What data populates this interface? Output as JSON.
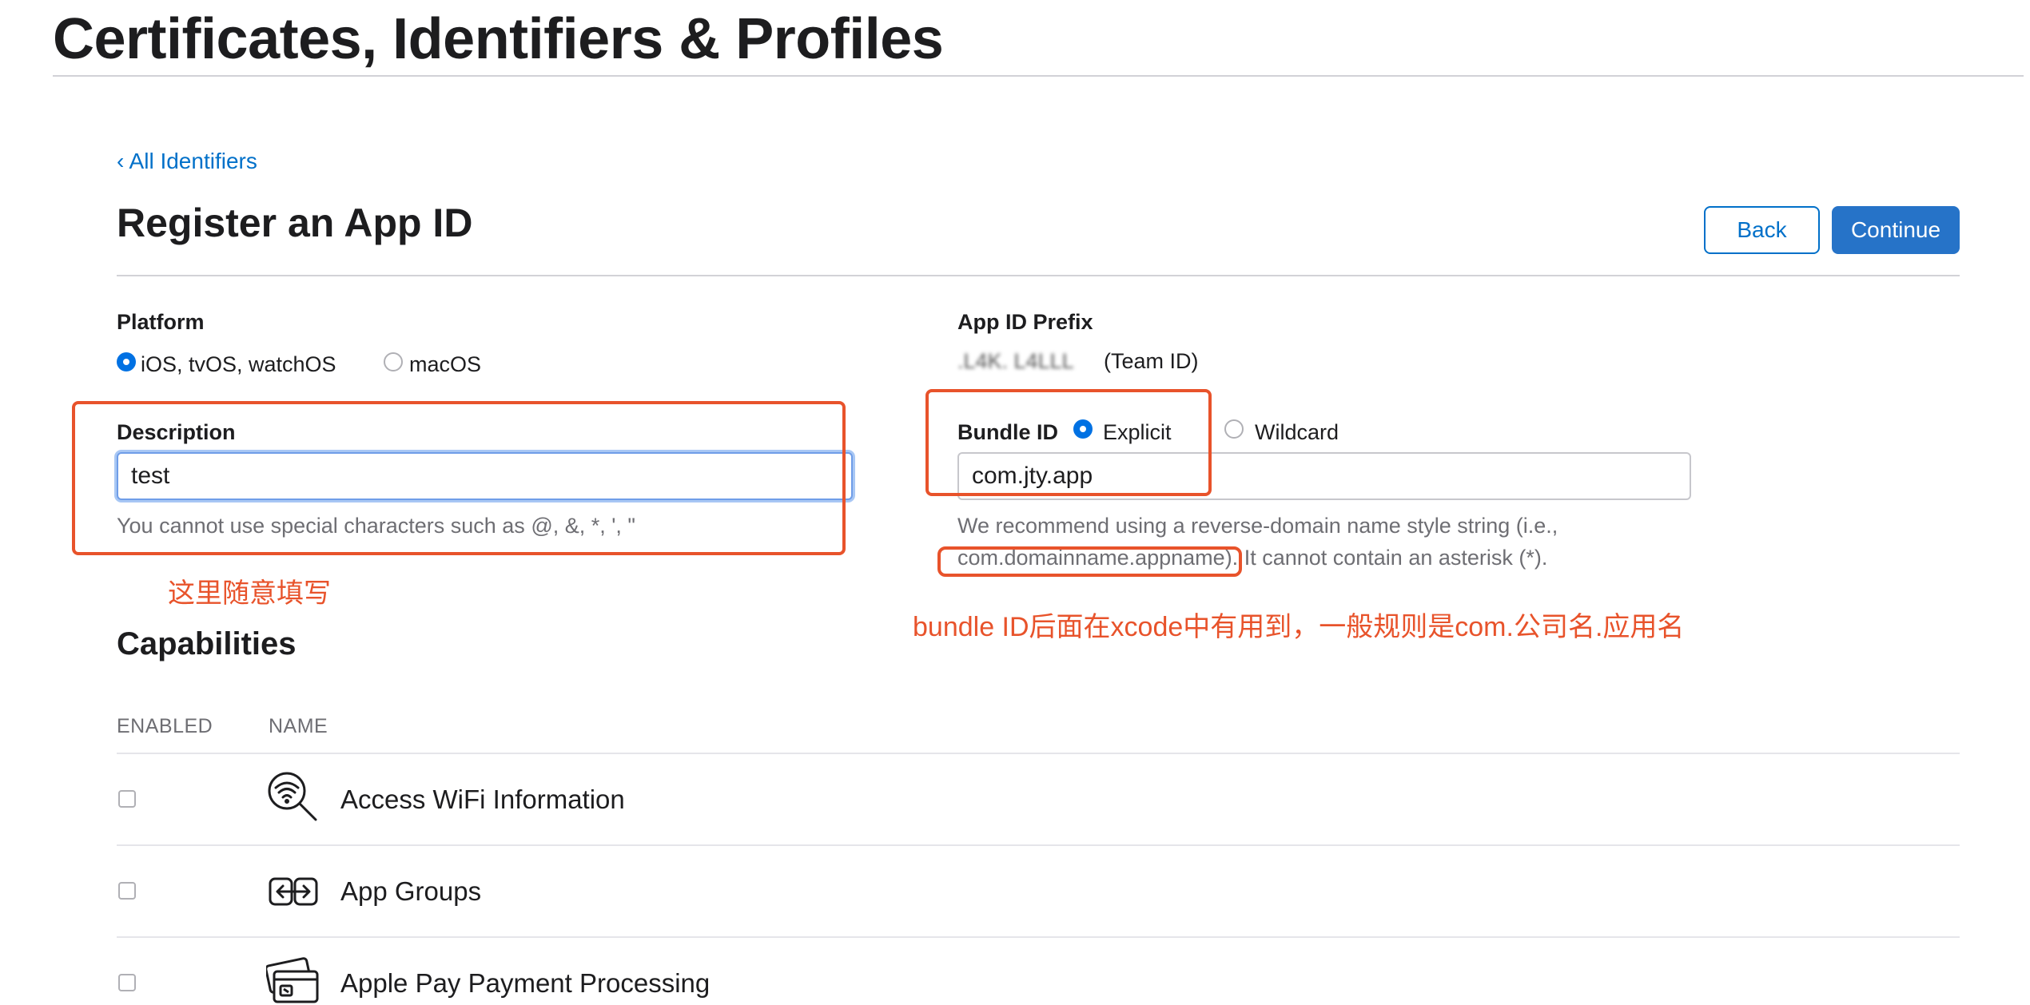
{
  "header": {
    "title": "Certificates, Identifiers & Profiles"
  },
  "nav": {
    "back_link": "‹ All Identifiers"
  },
  "section": {
    "title": "Register an App ID"
  },
  "buttons": {
    "back": "Back",
    "continue": "Continue"
  },
  "platform": {
    "label": "Platform",
    "options": [
      "iOS, tvOS, watchOS",
      "macOS"
    ],
    "selected": "iOS, tvOS, watchOS"
  },
  "app_id_prefix": {
    "label": "App ID Prefix",
    "value_redacted": ".L4K. L4LLL",
    "suffix": "(Team ID)"
  },
  "description": {
    "label": "Description",
    "value": "test",
    "hint": "You cannot use special characters such as @, &, *, ', \""
  },
  "bundle_id": {
    "label": "Bundle ID",
    "options": [
      "Explicit",
      "Wildcard"
    ],
    "selected": "Explicit",
    "value": "com.jty.app",
    "hint_line1": "We recommend using a reverse-domain name style string (i.e.,",
    "hint_line2_highlight": "com.domainname.appname).",
    "hint_line2_rest": " It cannot contain an asterisk (*)."
  },
  "annotations": {
    "description_note": "这里随意填写",
    "bundle_note": "bundle ID后面在xcode中有用到，一般规则是com.公司名.应用名",
    "color": "#e8532b"
  },
  "capabilities": {
    "title": "Capabilities",
    "columns": {
      "enabled": "ENABLED",
      "name": "NAME"
    },
    "rows": [
      {
        "name": "Access WiFi Information",
        "icon": "wifi-search-icon",
        "enabled": false
      },
      {
        "name": "App Groups",
        "icon": "app-groups-icon",
        "enabled": false
      },
      {
        "name": "Apple Pay Payment Processing",
        "icon": "apple-pay-cards-icon",
        "enabled": false
      }
    ]
  },
  "colors": {
    "accent": "#0070c9",
    "primary_button": "#2673c8",
    "radio_selected": "#0071e3"
  }
}
